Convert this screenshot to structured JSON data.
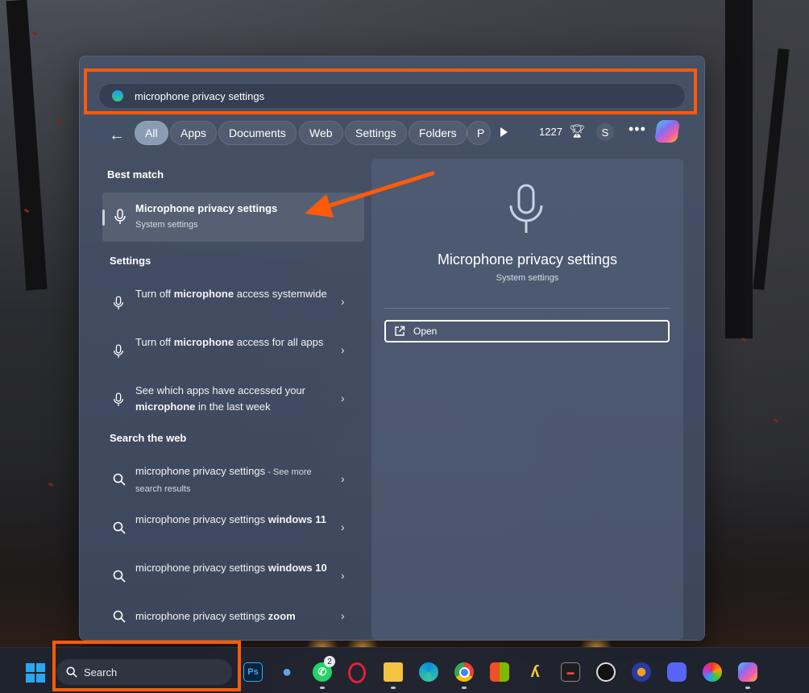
{
  "search": {
    "query": "microphone privacy settings"
  },
  "filters": {
    "tabs": [
      "All",
      "Apps",
      "Documents",
      "Web",
      "Settings",
      "Folders",
      "P"
    ],
    "active": "All",
    "points": "1227",
    "avatar_letter": "S"
  },
  "best_match": {
    "heading": "Best match",
    "title": "Microphone privacy settings",
    "subtitle": "System settings"
  },
  "settings": {
    "heading": "Settings",
    "items": [
      {
        "pre": "Turn off ",
        "bold": "microphone",
        "post": " access systemwide"
      },
      {
        "pre": "Turn off ",
        "bold": "microphone",
        "post": " access for all apps"
      },
      {
        "pre": "See which apps have accessed your ",
        "bold": "microphone",
        "post": " in the last week"
      }
    ]
  },
  "web": {
    "heading": "Search the web",
    "items": [
      {
        "main": "microphone privacy settings",
        "suffix": " - See more search results",
        "bold": ""
      },
      {
        "main": "microphone privacy settings ",
        "bold": "windows 11",
        "suffix": ""
      },
      {
        "main": "microphone privacy settings ",
        "bold": "windows 10",
        "suffix": ""
      },
      {
        "main": "microphone privacy settings ",
        "bold": "zoom",
        "suffix": ""
      }
    ]
  },
  "preview": {
    "title": "Microphone privacy settings",
    "subtitle": "System settings",
    "open_label": "Open"
  },
  "taskbar": {
    "search_label": "Search",
    "whatsapp_badge": "2",
    "apps": [
      "photoshop",
      "teams-people",
      "whatsapp",
      "opera",
      "file-explorer",
      "edge",
      "chrome",
      "microsoft-store",
      "app-yellow",
      "terminal-app",
      "obs",
      "audio-app",
      "discord",
      "color-app",
      "copilot"
    ]
  },
  "colors": {
    "highlight": "#ff5a0a",
    "accent": "#2aa8ef"
  }
}
